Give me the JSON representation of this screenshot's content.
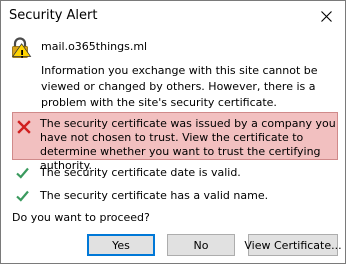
{
  "window": {
    "title": "Security Alert",
    "close_icon": "close-icon"
  },
  "site": {
    "name": "mail.o365things.ml",
    "icon": "certificate-warning-icon"
  },
  "info": "Information you exchange with this site cannot be viewed or changed by others. However, there is a problem with the site's security certificate.",
  "error": {
    "icon": "red-x-icon",
    "color": "#f2c0c0",
    "text": "The security certificate was issued by a company you have not chosen to trust. View the certificate to determine whether you want to trust the certifying authority."
  },
  "checks": [
    {
      "icon": "green-check-icon",
      "text": "The security certificate date is valid."
    },
    {
      "icon": "green-check-icon",
      "text": "The security certificate has a valid name."
    }
  ],
  "question": "Do you want to proceed?",
  "buttons": {
    "yes": "Yes",
    "no": "No",
    "view": "View Certificate...",
    "accent": "#0078d7"
  }
}
